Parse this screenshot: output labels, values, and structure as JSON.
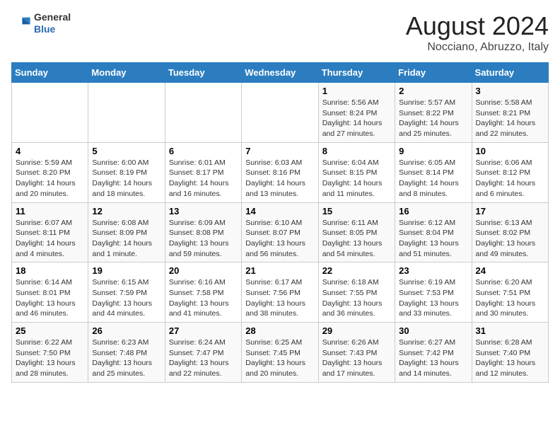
{
  "header": {
    "title": "August 2024",
    "subtitle": "Nocciano, Abruzzo, Italy",
    "logo_general": "General",
    "logo_blue": "Blue"
  },
  "weekdays": [
    "Sunday",
    "Monday",
    "Tuesday",
    "Wednesday",
    "Thursday",
    "Friday",
    "Saturday"
  ],
  "weeks": [
    [
      {
        "day": "",
        "info": ""
      },
      {
        "day": "",
        "info": ""
      },
      {
        "day": "",
        "info": ""
      },
      {
        "day": "",
        "info": ""
      },
      {
        "day": "1",
        "info": "Sunrise: 5:56 AM\nSunset: 8:24 PM\nDaylight: 14 hours and 27 minutes."
      },
      {
        "day": "2",
        "info": "Sunrise: 5:57 AM\nSunset: 8:22 PM\nDaylight: 14 hours and 25 minutes."
      },
      {
        "day": "3",
        "info": "Sunrise: 5:58 AM\nSunset: 8:21 PM\nDaylight: 14 hours and 22 minutes."
      }
    ],
    [
      {
        "day": "4",
        "info": "Sunrise: 5:59 AM\nSunset: 8:20 PM\nDaylight: 14 hours and 20 minutes."
      },
      {
        "day": "5",
        "info": "Sunrise: 6:00 AM\nSunset: 8:19 PM\nDaylight: 14 hours and 18 minutes."
      },
      {
        "day": "6",
        "info": "Sunrise: 6:01 AM\nSunset: 8:17 PM\nDaylight: 14 hours and 16 minutes."
      },
      {
        "day": "7",
        "info": "Sunrise: 6:03 AM\nSunset: 8:16 PM\nDaylight: 14 hours and 13 minutes."
      },
      {
        "day": "8",
        "info": "Sunrise: 6:04 AM\nSunset: 8:15 PM\nDaylight: 14 hours and 11 minutes."
      },
      {
        "day": "9",
        "info": "Sunrise: 6:05 AM\nSunset: 8:14 PM\nDaylight: 14 hours and 8 minutes."
      },
      {
        "day": "10",
        "info": "Sunrise: 6:06 AM\nSunset: 8:12 PM\nDaylight: 14 hours and 6 minutes."
      }
    ],
    [
      {
        "day": "11",
        "info": "Sunrise: 6:07 AM\nSunset: 8:11 PM\nDaylight: 14 hours and 4 minutes."
      },
      {
        "day": "12",
        "info": "Sunrise: 6:08 AM\nSunset: 8:09 PM\nDaylight: 14 hours and 1 minute."
      },
      {
        "day": "13",
        "info": "Sunrise: 6:09 AM\nSunset: 8:08 PM\nDaylight: 13 hours and 59 minutes."
      },
      {
        "day": "14",
        "info": "Sunrise: 6:10 AM\nSunset: 8:07 PM\nDaylight: 13 hours and 56 minutes."
      },
      {
        "day": "15",
        "info": "Sunrise: 6:11 AM\nSunset: 8:05 PM\nDaylight: 13 hours and 54 minutes."
      },
      {
        "day": "16",
        "info": "Sunrise: 6:12 AM\nSunset: 8:04 PM\nDaylight: 13 hours and 51 minutes."
      },
      {
        "day": "17",
        "info": "Sunrise: 6:13 AM\nSunset: 8:02 PM\nDaylight: 13 hours and 49 minutes."
      }
    ],
    [
      {
        "day": "18",
        "info": "Sunrise: 6:14 AM\nSunset: 8:01 PM\nDaylight: 13 hours and 46 minutes."
      },
      {
        "day": "19",
        "info": "Sunrise: 6:15 AM\nSunset: 7:59 PM\nDaylight: 13 hours and 44 minutes."
      },
      {
        "day": "20",
        "info": "Sunrise: 6:16 AM\nSunset: 7:58 PM\nDaylight: 13 hours and 41 minutes."
      },
      {
        "day": "21",
        "info": "Sunrise: 6:17 AM\nSunset: 7:56 PM\nDaylight: 13 hours and 38 minutes."
      },
      {
        "day": "22",
        "info": "Sunrise: 6:18 AM\nSunset: 7:55 PM\nDaylight: 13 hours and 36 minutes."
      },
      {
        "day": "23",
        "info": "Sunrise: 6:19 AM\nSunset: 7:53 PM\nDaylight: 13 hours and 33 minutes."
      },
      {
        "day": "24",
        "info": "Sunrise: 6:20 AM\nSunset: 7:51 PM\nDaylight: 13 hours and 30 minutes."
      }
    ],
    [
      {
        "day": "25",
        "info": "Sunrise: 6:22 AM\nSunset: 7:50 PM\nDaylight: 13 hours and 28 minutes."
      },
      {
        "day": "26",
        "info": "Sunrise: 6:23 AM\nSunset: 7:48 PM\nDaylight: 13 hours and 25 minutes."
      },
      {
        "day": "27",
        "info": "Sunrise: 6:24 AM\nSunset: 7:47 PM\nDaylight: 13 hours and 22 minutes."
      },
      {
        "day": "28",
        "info": "Sunrise: 6:25 AM\nSunset: 7:45 PM\nDaylight: 13 hours and 20 minutes."
      },
      {
        "day": "29",
        "info": "Sunrise: 6:26 AM\nSunset: 7:43 PM\nDaylight: 13 hours and 17 minutes."
      },
      {
        "day": "30",
        "info": "Sunrise: 6:27 AM\nSunset: 7:42 PM\nDaylight: 13 hours and 14 minutes."
      },
      {
        "day": "31",
        "info": "Sunrise: 6:28 AM\nSunset: 7:40 PM\nDaylight: 13 hours and 12 minutes."
      }
    ]
  ]
}
